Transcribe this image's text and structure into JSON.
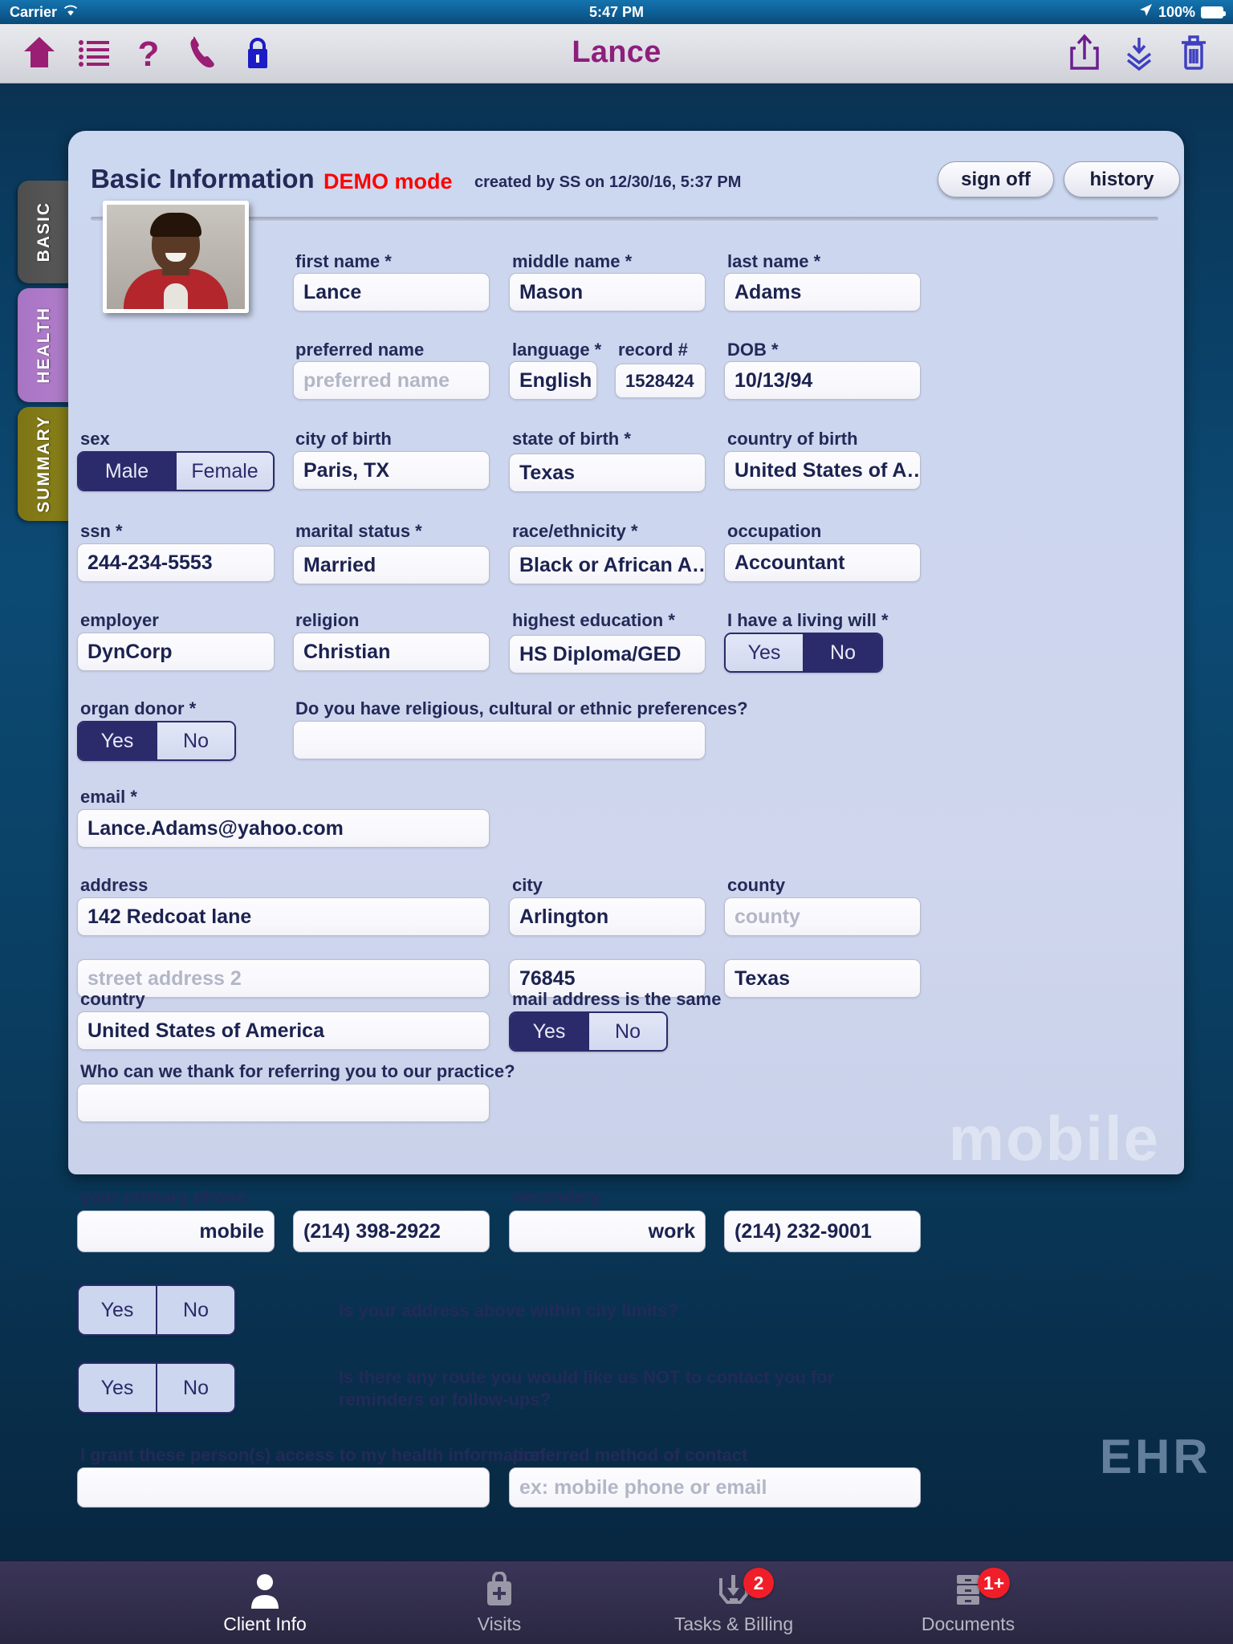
{
  "status_bar": {
    "carrier": "Carrier",
    "time": "5:47 PM",
    "battery": "100%",
    "wifi_icon": "wifi-icon",
    "location_icon": "location-arrow-icon",
    "battery_icon": "battery-full-icon"
  },
  "nav_bar": {
    "title": "Lance",
    "left_icons": [
      "home-icon",
      "list-icon",
      "question-icon",
      "phone-icon",
      "lock-icon"
    ],
    "right_icons": [
      "share-icon",
      "collapse-icon",
      "trash-icon"
    ]
  },
  "side_tabs": [
    {
      "label": "BASIC",
      "color": "#555555"
    },
    {
      "label": "HEALTH",
      "color": "#ab77c6"
    },
    {
      "label": "SUMMARY",
      "color": "#837a17"
    }
  ],
  "card_header": {
    "title": "Basic Information",
    "demo_mode": "DEMO mode",
    "demo_color": "#fd0303",
    "created": "created by SS on 12/30/16, 5:37 PM",
    "sign_off_label": "sign off",
    "history_label": "history"
  },
  "form": {
    "first_name": {
      "label": "first name *",
      "value": "Lance"
    },
    "middle_name": {
      "label": "middle name *",
      "value": "Mason"
    },
    "last_name": {
      "label": "last name *",
      "value": "Adams"
    },
    "preferred_name": {
      "label": "preferred name",
      "value": "",
      "placeholder": "preferred name"
    },
    "language": {
      "label": "language *",
      "value": "English"
    },
    "record_number": {
      "label": "record #",
      "value": "1528424"
    },
    "dob": {
      "label": "DOB *",
      "value": "10/13/94"
    },
    "sex": {
      "label": "sex",
      "options": [
        "Male",
        "Female"
      ],
      "selected": "Male"
    },
    "city_of_birth": {
      "label": "city of birth",
      "value": "Paris, TX"
    },
    "state_of_birth": {
      "label": "state of birth *",
      "value": "Texas"
    },
    "country_of_birth": {
      "label": "country of birth",
      "value": "United States of A…"
    },
    "ssn": {
      "label": "ssn *",
      "value": "244-234-5553"
    },
    "marital_status": {
      "label": "marital status *",
      "value": "Married"
    },
    "race_ethnicity": {
      "label": "race/ethnicity *",
      "value": "Black or African A…"
    },
    "occupation": {
      "label": "occupation",
      "value": "Accountant"
    },
    "employer": {
      "label": "employer",
      "value": "DynCorp"
    },
    "religion": {
      "label": "religion",
      "value": "Christian"
    },
    "highest_education": {
      "label": "highest education *",
      "value": "HS Diploma/GED"
    },
    "living_will": {
      "label": "I have a living will *",
      "options": [
        "Yes",
        "No"
      ],
      "selected": "No"
    },
    "organ_donor": {
      "label": "organ donor *",
      "options": [
        "Yes",
        "No"
      ],
      "selected": "Yes"
    },
    "religious_prefs": {
      "label": "Do you have religious, cultural or ethnic preferences?",
      "value": ""
    },
    "email": {
      "label": "email *",
      "value": "Lance.Adams@yahoo.com"
    },
    "address": {
      "label": "address",
      "value": "142 Redcoat lane"
    },
    "address2": {
      "label": "",
      "value": "",
      "placeholder": "street address 2"
    },
    "city": {
      "label": "city",
      "value": "Arlington"
    },
    "zip": {
      "label": "",
      "value": "76845"
    },
    "county": {
      "label": "county",
      "value": "",
      "placeholder": "county"
    },
    "state": {
      "label": "",
      "value": "Texas"
    },
    "country": {
      "label": "country",
      "value": "United States of America"
    },
    "mail_same": {
      "label": "mail address is the same",
      "options": [
        "Yes",
        "No"
      ],
      "selected": "Yes"
    },
    "referral": {
      "label": "Who can we thank for referring you to our practice?",
      "value": ""
    },
    "primary_phone": {
      "label": "your primary phone",
      "type_value": "mobile",
      "number": "(214) 398-2922"
    },
    "secondary_phone": {
      "label": "secondary",
      "type_value": "work",
      "number": "(214) 232-9001"
    },
    "city_limits": {
      "label": "Is your address above within city limits?",
      "options": [
        "Yes",
        "No"
      ],
      "selected": ""
    },
    "no_contact_route": {
      "label": "Is there any route you would like us NOT to contact you for reminders or follow-ups?",
      "options": [
        "Yes",
        "No"
      ],
      "selected": ""
    },
    "grant_access": {
      "label": "I grant these person(s) access to my health information",
      "value": ""
    },
    "preferred_contact": {
      "label": "preferred method of contact",
      "value": "",
      "placeholder": "ex: mobile phone or email"
    }
  },
  "watermark": {
    "line1": "mobile",
    "line2": "EHR"
  },
  "tab_bar": [
    {
      "label": "Client Info",
      "icon": "person-icon",
      "badge": "",
      "active": true
    },
    {
      "label": "Visits",
      "icon": "medical-bag-icon",
      "badge": "",
      "active": false
    },
    {
      "label": "Tasks & Billing",
      "icon": "inbox-download-icon",
      "badge": "2",
      "active": false
    },
    {
      "label": "Documents",
      "icon": "file-cabinet-icon",
      "badge": "1+",
      "active": false
    }
  ]
}
